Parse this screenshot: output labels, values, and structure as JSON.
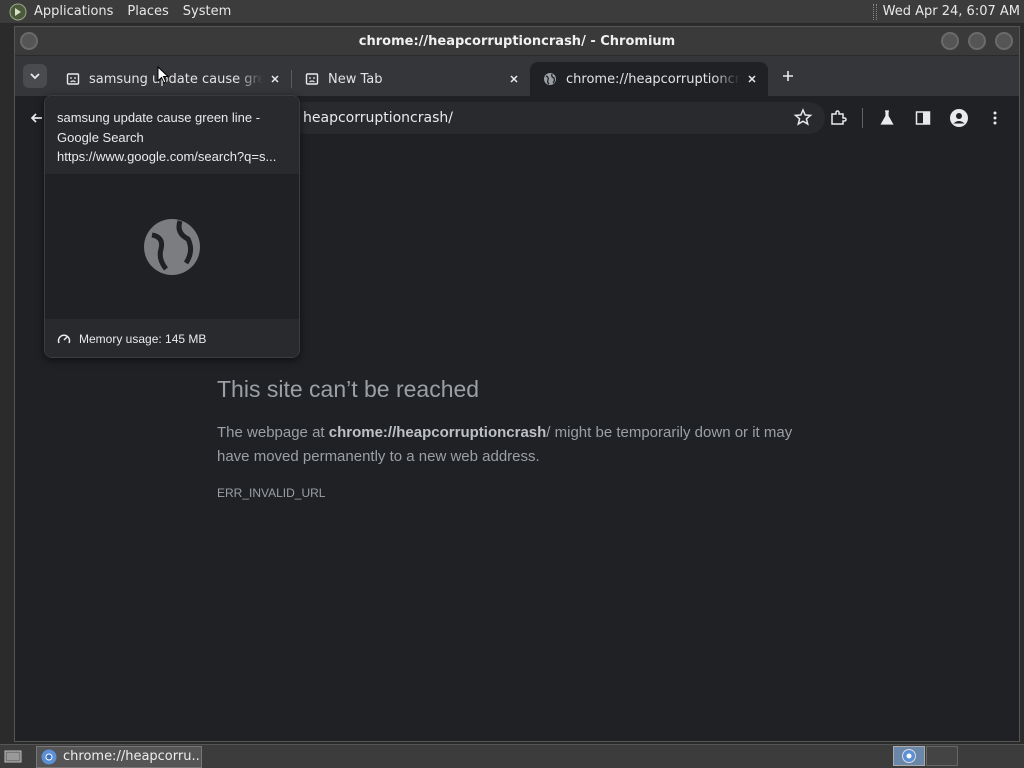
{
  "top_panel": {
    "menus": [
      "Applications",
      "Places",
      "System"
    ],
    "clock": "Wed Apr 24,  6:07 AM"
  },
  "window": {
    "title": "chrome://heapcorruptioncrash/ - Chromium"
  },
  "tabs": [
    {
      "title": "samsung update cause green line - Google Search",
      "favicon": "sad-page-icon",
      "active": false
    },
    {
      "title": "New Tab",
      "favicon": "sad-page-icon",
      "active": false
    },
    {
      "title": "chrome://heapcorruptioncrash/",
      "favicon": "globe-icon",
      "active": true
    }
  ],
  "omnibox": {
    "url": "heapcorruptioncrash/"
  },
  "hover_card": {
    "title": "samsung update cause green line - Google Search",
    "url": "https://www.google.com/search?q=s...",
    "memory": "Memory usage: 145 MB"
  },
  "error_page": {
    "title": "This site can’t be reached",
    "desc_prefix": "The webpage at ",
    "desc_url_scheme": "chrome://",
    "desc_url_host": "heapcorruptioncrash",
    "desc_suffix": "/ might be temporarily down or it may have moved permanently to a new web address.",
    "code": "ERR_INVALID_URL"
  },
  "taskbar": {
    "task_label": "chrome://heapcorru..."
  },
  "colors": {
    "page_bg": "#202124",
    "tabstrip_bg": "#35363a",
    "panel_bg": "#3c3c3c",
    "error_text": "#9aa0a6"
  }
}
